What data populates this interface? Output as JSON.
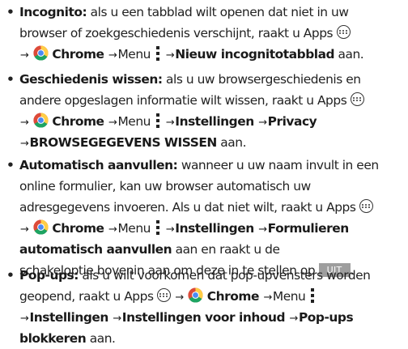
{
  "sections": [
    {
      "heading": "Incognito:",
      "text": [
        " als u een tabblad wilt openen dat niet in uw",
        "browser of zoekgeschiedenis verschijnt, raakt u Apps",
        "Chrome",
        "Menu",
        "Nieuw incognitotabblad",
        " aan."
      ]
    },
    {
      "heading": "Geschiedenis wissen:",
      "text": [
        " als u uw browsergeschiedenis en",
        "andere opgeslagen informatie wilt wissen, raakt u Apps",
        "Chrome",
        "Menu",
        "Instellingen",
        "Privacy",
        "BROWSEGEGEVENS WISSEN",
        " aan."
      ]
    },
    {
      "heading": "Automatisch aanvullen:",
      "text": [
        " wanneer u uw naam invult in een",
        "online formulier, kan uw browser automatisch uw",
        "adresgegevens invoeren. Als u dat niet wilt, raakt u Apps",
        "Chrome",
        "Menu",
        "Instellingen",
        "Formulieren",
        "automatisch aanvullen",
        " aan en raakt u de",
        "schakeloptie bovenin aan om deze in te stellen op",
        "UIT",
        "."
      ]
    },
    {
      "heading": "Pop-ups:",
      "text": [
        " als u wilt voorkomen dat pop-upvensters worden",
        "geopend, raakt u Apps",
        "Chrome",
        "Menu",
        "Instellingen",
        "Instellingen voor inhoud",
        "Pop-ups",
        "blokkeren",
        " aan."
      ]
    }
  ],
  "icons": {
    "apps": "apps-icon",
    "chrome": "chrome-icon",
    "menu": "menu-dots-icon"
  },
  "colors": {
    "toggle_bg": "#9e9e9e",
    "text": "#222222"
  }
}
